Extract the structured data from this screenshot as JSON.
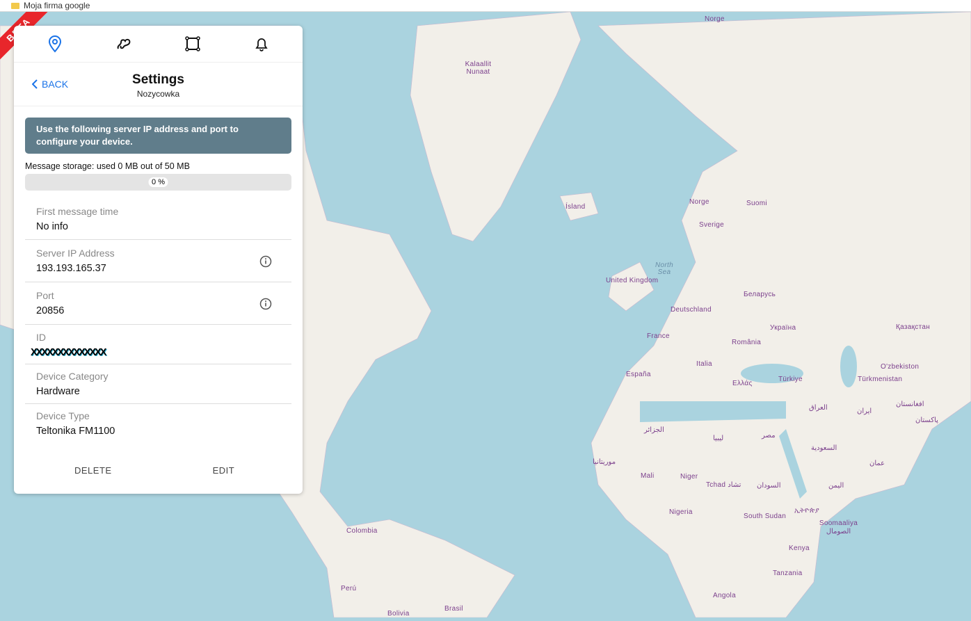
{
  "bookmarks": {
    "item": "Moja firma google"
  },
  "beta": "BETA",
  "panel": {
    "back": "BACK",
    "title": "Settings",
    "subtitle": "Nozycowka",
    "notice": "Use the following server IP address and port to configure your device.",
    "storage": "Message storage: used 0 MB out of 50 MB",
    "progress_label": "0 %",
    "progress": 0,
    "fields": [
      {
        "label": "First message time",
        "value": "No info"
      },
      {
        "label": "Server IP Address",
        "value": "193.193.165.37"
      },
      {
        "label": "Port",
        "value": "20856"
      },
      {
        "label": "ID",
        "value": "XXXXXXXXXXXXXX"
      },
      {
        "label": "Device Category",
        "value": "Hardware"
      },
      {
        "label": "Device Type",
        "value": "Teltonika FM1100"
      }
    ],
    "delete": "DELETE",
    "edit": "EDIT"
  },
  "map_labels": [
    "Norge",
    "Kalaallit Nunaat",
    "Ísland",
    "Norge",
    "Suomi",
    "Sverige",
    "North Sea",
    "United Kingdom",
    "Беларусь",
    "Deutschland",
    "Україна",
    "Қазақстан",
    "France",
    "România",
    "Italia",
    "O'zbekiston",
    "España",
    "Ελλάς",
    "Türkiye",
    "Türkmenistan",
    "العراق",
    "ایران",
    "افغانستان",
    "پاکستان",
    "الجزائر",
    "ليبيا",
    "مصر",
    "السعودية",
    "موريتانيا",
    "عمان",
    "Mali",
    "Niger",
    "Tchad تشاد",
    "السودان",
    "اليمن",
    "Nigeria",
    "South Sudan",
    "ኢትዮጵያ",
    "Soomaaliya الصومال",
    "Colombia",
    "Kenya",
    "Tanzania",
    "Perú",
    "Angola",
    "Bolivia",
    "Brasil"
  ]
}
